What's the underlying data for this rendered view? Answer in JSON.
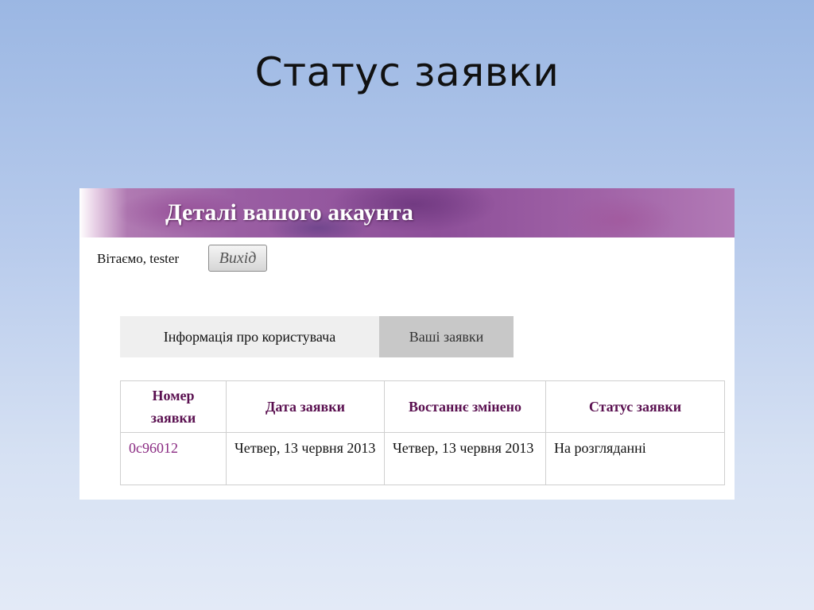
{
  "slide": {
    "title": "Статус заявки"
  },
  "account": {
    "banner_title": "Деталі вашого акаунта",
    "greeting": "Вітаємо, tester",
    "logout_label": "Вихід"
  },
  "tabs": [
    {
      "label": "Інформація про користувача",
      "active": false
    },
    {
      "label": "Ваші заявки",
      "active": true
    }
  ],
  "table": {
    "headers": [
      "Номер заявки",
      "Дата заявки",
      "Востаннє змінено",
      "Статус заявки"
    ],
    "rows": [
      {
        "id": "0c96012",
        "date": "Четвер, 13 червня 2013",
        "modified": "Четвер, 13 червня 2013",
        "status": "На розгляданні"
      }
    ]
  },
  "colors": {
    "header_text": "#5a1050",
    "link": "#8a2a82",
    "active_tab": "#c8c8c8"
  }
}
